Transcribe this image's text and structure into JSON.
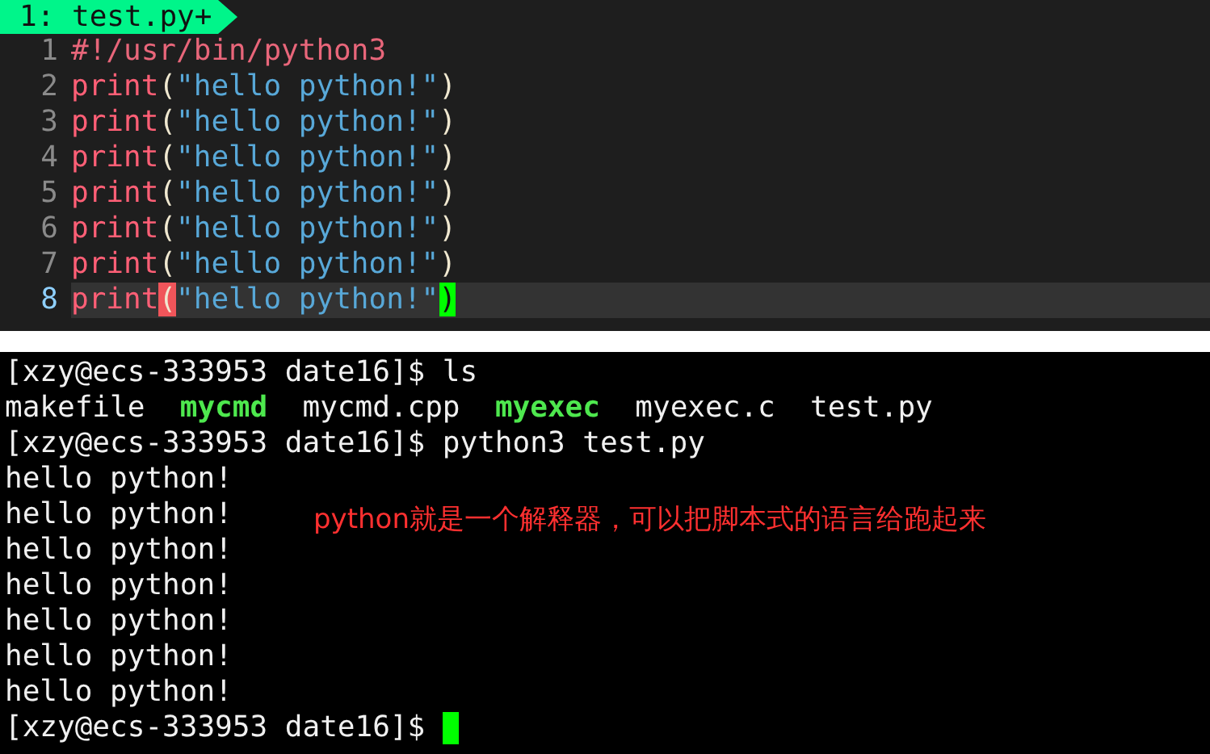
{
  "editor": {
    "tab": {
      "label": "1: test.py+"
    },
    "lines": [
      {
        "number": "1",
        "current": false,
        "tokens": [
          {
            "kind": "shebang",
            "text": "#!/usr/bin/python3"
          }
        ]
      },
      {
        "number": "2",
        "current": false,
        "tokens": [
          {
            "kind": "keyword",
            "text": "print"
          },
          {
            "kind": "bracket",
            "text": "("
          },
          {
            "kind": "string",
            "text": "\"hello python!\""
          },
          {
            "kind": "bracket",
            "text": ")"
          }
        ]
      },
      {
        "number": "3",
        "current": false,
        "tokens": [
          {
            "kind": "keyword",
            "text": "print"
          },
          {
            "kind": "bracket",
            "text": "("
          },
          {
            "kind": "string",
            "text": "\"hello python!\""
          },
          {
            "kind": "bracket",
            "text": ")"
          }
        ]
      },
      {
        "number": "4",
        "current": false,
        "tokens": [
          {
            "kind": "keyword",
            "text": "print"
          },
          {
            "kind": "bracket",
            "text": "("
          },
          {
            "kind": "string",
            "text": "\"hello python!\""
          },
          {
            "kind": "bracket",
            "text": ")"
          }
        ]
      },
      {
        "number": "5",
        "current": false,
        "tokens": [
          {
            "kind": "keyword",
            "text": "print"
          },
          {
            "kind": "bracket",
            "text": "("
          },
          {
            "kind": "string",
            "text": "\"hello python!\""
          },
          {
            "kind": "bracket",
            "text": ")"
          }
        ]
      },
      {
        "number": "6",
        "current": false,
        "tokens": [
          {
            "kind": "keyword",
            "text": "print"
          },
          {
            "kind": "bracket",
            "text": "("
          },
          {
            "kind": "string",
            "text": "\"hello python!\""
          },
          {
            "kind": "bracket",
            "text": ")"
          }
        ]
      },
      {
        "number": "7",
        "current": false,
        "tokens": [
          {
            "kind": "keyword",
            "text": "print"
          },
          {
            "kind": "bracket",
            "text": "("
          },
          {
            "kind": "string",
            "text": "\"hello python!\""
          },
          {
            "kind": "bracket",
            "text": ")"
          }
        ]
      },
      {
        "number": "8",
        "current": true,
        "tokens": [
          {
            "kind": "keyword",
            "text": "print"
          },
          {
            "kind": "bracket-pair",
            "text": "("
          },
          {
            "kind": "string",
            "text": "\"hello python!\""
          },
          {
            "kind": "bracket-cursor",
            "text": ")"
          }
        ]
      }
    ]
  },
  "terminal": {
    "lines": [
      {
        "segments": [
          {
            "kind": "text",
            "text": "[xzy@ecs-333953 date16]$ ls"
          }
        ]
      },
      {
        "segments": [
          {
            "kind": "text",
            "text": "makefile  "
          },
          {
            "kind": "executable",
            "text": "mycmd"
          },
          {
            "kind": "text",
            "text": "  mycmd.cpp  "
          },
          {
            "kind": "executable",
            "text": "myexec"
          },
          {
            "kind": "text",
            "text": "  myexec.c  test.py"
          }
        ]
      },
      {
        "segments": [
          {
            "kind": "text",
            "text": "[xzy@ecs-333953 date16]$ python3 test.py"
          }
        ]
      },
      {
        "segments": [
          {
            "kind": "text",
            "text": "hello python!"
          }
        ]
      },
      {
        "segments": [
          {
            "kind": "text",
            "text": "hello python!"
          }
        ]
      },
      {
        "segments": [
          {
            "kind": "text",
            "text": "hello python!"
          }
        ]
      },
      {
        "segments": [
          {
            "kind": "text",
            "text": "hello python!"
          }
        ]
      },
      {
        "segments": [
          {
            "kind": "text",
            "text": "hello python!"
          }
        ]
      },
      {
        "segments": [
          {
            "kind": "text",
            "text": "hello python!"
          }
        ]
      },
      {
        "segments": [
          {
            "kind": "text",
            "text": "hello python!"
          }
        ]
      },
      {
        "cursor": true,
        "segments": [
          {
            "kind": "text",
            "text": "[xzy@ecs-333953 date16]$ "
          }
        ]
      }
    ],
    "annotation": "python就是一个解释器，可以把脚本式的语言给跑起来"
  }
}
